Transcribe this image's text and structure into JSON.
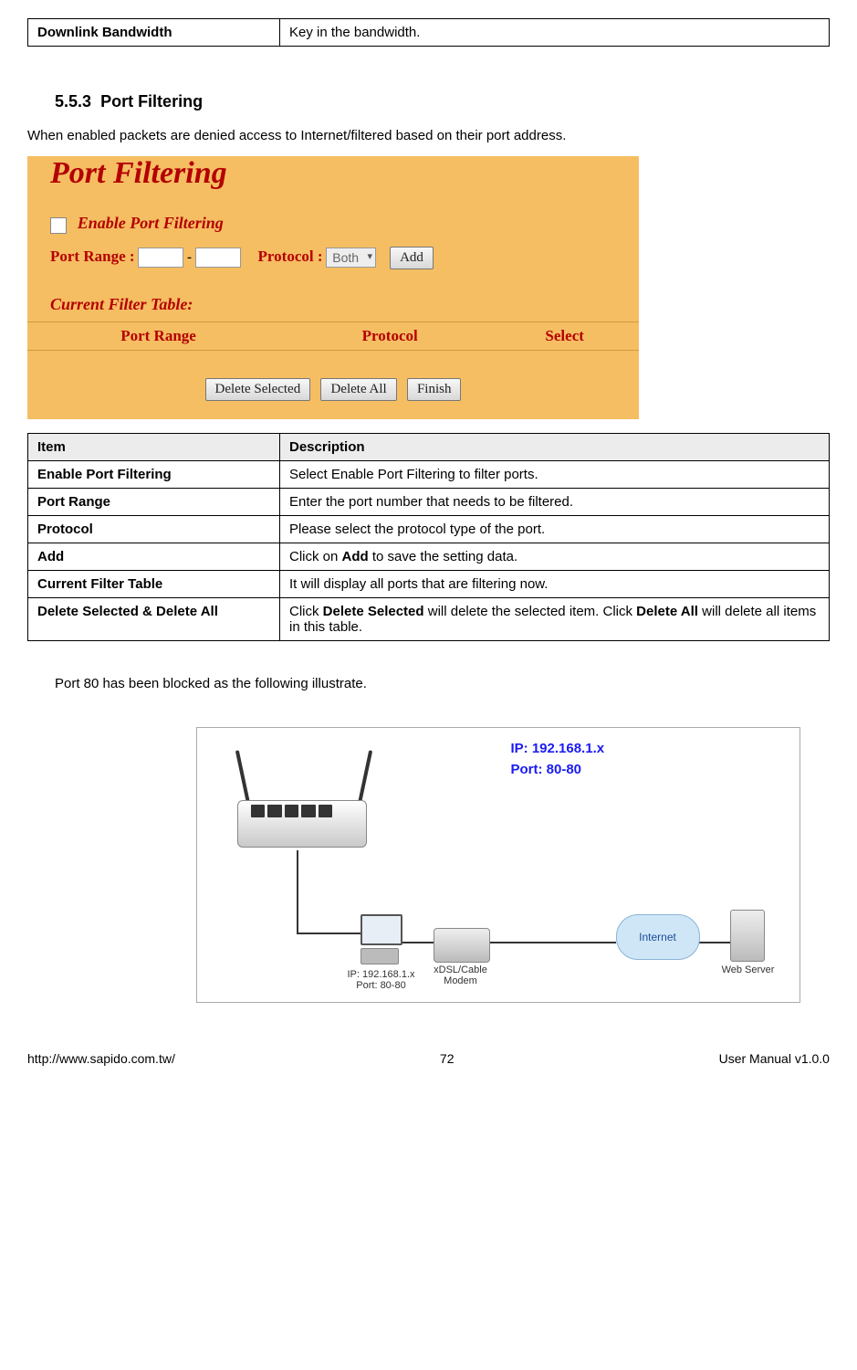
{
  "topTable": {
    "item": "Downlink Bandwidth",
    "desc": "Key in the bandwidth."
  },
  "section": {
    "number": "5.5.3",
    "title": "Port Filtering"
  },
  "intro": "When enabled packets are denied access to Internet/filtered based on their port address.",
  "ui": {
    "title": "Port Filtering",
    "enableLabel": "Enable Port Filtering",
    "portRangeLabel": "Port Range :",
    "protocolLabel": "Protocol :",
    "protocolValue": "Both",
    "addBtn": "Add",
    "currentFilterLabel": "Current Filter Table:",
    "th1": "Port Range",
    "th2": "Protocol",
    "th3": "Select",
    "deleteSelectedBtn": "Delete Selected",
    "deleteAllBtn": "Delete All",
    "finishBtn": "Finish"
  },
  "descTable": {
    "h1": "Item",
    "h2": "Description",
    "rows": [
      {
        "item": "Enable Port Filtering",
        "desc": "Select Enable Port Filtering to filter ports."
      },
      {
        "item": "Port Range",
        "desc": "Enter the port number that needs to be filtered."
      },
      {
        "item": "Protocol",
        "desc": "Please select the protocol type of the port."
      },
      {
        "item": "Add",
        "descPre": "Click on ",
        "descBold": "Add",
        "descPost": " to save the setting data."
      },
      {
        "item": "Current Filter Table",
        "desc": "It will display all ports that are filtering now."
      },
      {
        "item": "Delete Selected & Delete All",
        "descPre": "Click ",
        "descBold": "Delete Selected",
        "descMid": " will delete the selected item. Click ",
        "descBold2": "Delete All",
        "descPost": " will delete all items in this table."
      }
    ]
  },
  "blockedNote": "Port 80 has been blocked as the following illustrate.",
  "diagram": {
    "ipLine": "IP: 192.168.1.x",
    "portLine": "Port: 80-80",
    "pcCaption1": "IP: 192.168.1.x",
    "pcCaption2": "Port: 80-80",
    "modemCaption1": "xDSL/Cable",
    "modemCaption2": "Modem",
    "cloudLabel": "Internet",
    "serverCaption": "Web Server"
  },
  "footer": {
    "url": "http://www.sapido.com.tw/",
    "pageNum": "72",
    "version": "User Manual v1.0.0"
  }
}
